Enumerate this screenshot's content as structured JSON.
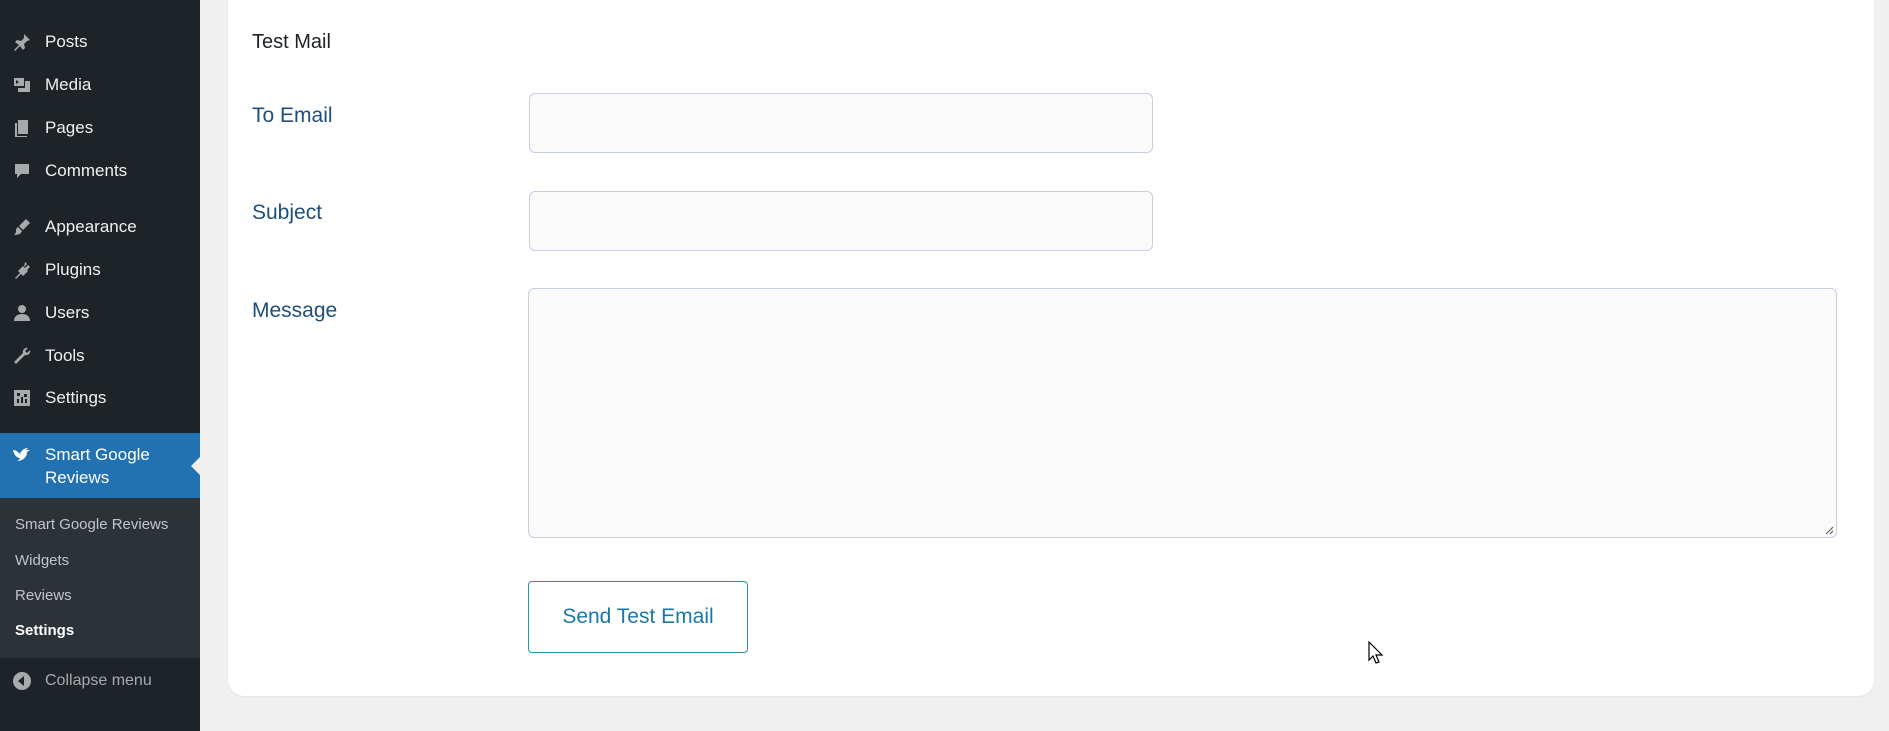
{
  "sidebar": {
    "items": [
      {
        "label": "Posts",
        "icon": "pushpin-icon"
      },
      {
        "label": "Media",
        "icon": "media-icon"
      },
      {
        "label": "Pages",
        "icon": "pages-icon"
      },
      {
        "label": "Comments",
        "icon": "comment-icon"
      },
      {
        "label": "Appearance",
        "icon": "paintbrush-icon"
      },
      {
        "label": "Plugins",
        "icon": "plugin-icon"
      },
      {
        "label": "Users",
        "icon": "user-icon"
      },
      {
        "label": "Tools",
        "icon": "wrench-icon"
      },
      {
        "label": "Settings",
        "icon": "settings-icon"
      }
    ],
    "active": {
      "label_line1": "Smart Google",
      "label_line2": "Reviews",
      "icon": "bird-icon"
    },
    "submenu": [
      "Smart Google Reviews",
      "Widgets",
      "Reviews",
      "Settings"
    ],
    "current_submenu": "Settings",
    "collapse_label": "Collapse menu"
  },
  "main": {
    "section_title": "Test Mail",
    "fields": {
      "to_email": {
        "label": "To Email",
        "value": ""
      },
      "subject": {
        "label": "Subject",
        "value": ""
      },
      "message": {
        "label": "Message",
        "value": ""
      }
    },
    "send_button": "Send Test Email"
  },
  "colors": {
    "sidebar_bg": "#1d2327",
    "active_bg": "#2271b1",
    "label_color": "#1e4e79",
    "button_color": "#1a78a8"
  }
}
